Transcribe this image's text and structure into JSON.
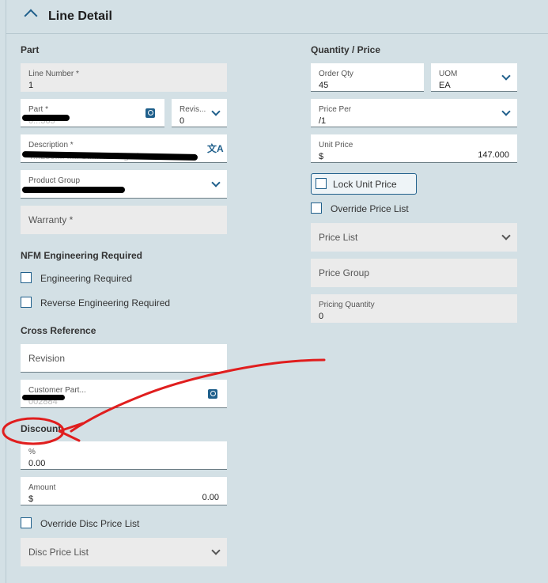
{
  "header": {
    "title": "Line Detail"
  },
  "part_section": {
    "title": "Part",
    "line_number": {
      "label": "Line Number *",
      "value": "1"
    },
    "part": {
      "label": "Part *",
      "value": "0...365"
    },
    "revision": {
      "label": "Revis...",
      "value": "0"
    },
    "description": {
      "label": "Description *",
      "value": "Y...250...P...ff St...k Mixing Pi..."
    },
    "product_group": {
      "label": "Product Group",
      "value": ""
    },
    "warranty": {
      "placeholder": "Warranty *"
    }
  },
  "nfm_section": {
    "title": "NFM Engineering Required",
    "engineering_required": "Engineering Required",
    "reverse_engineering_required": "Reverse Engineering Required"
  },
  "cross_ref_section": {
    "title": "Cross Reference",
    "revision": {
      "placeholder": "Revision"
    },
    "customer_part": {
      "label": "Customer Part...",
      "value": "002884"
    }
  },
  "discount_section": {
    "title": "Discount",
    "percent": {
      "label": "%",
      "value": "0.00"
    },
    "amount": {
      "label": "Amount",
      "currency": "$",
      "value": "0.00"
    },
    "override_disc": "Override Disc Price List",
    "disc_price_list": {
      "placeholder": "Disc Price List"
    }
  },
  "qty_section": {
    "title": "Quantity / Price",
    "order_qty": {
      "label": "Order Qty",
      "value": "45"
    },
    "uom": {
      "label": "UOM",
      "value": "EA"
    },
    "price_per": {
      "label": "Price Per",
      "value": "/1"
    },
    "unit_price": {
      "label": "Unit Price",
      "currency": "$",
      "value": "147.000"
    },
    "lock_unit_price": "Lock Unit Price",
    "override_price_list": "Override Price List",
    "price_list": {
      "placeholder": "Price List"
    },
    "price_group": {
      "placeholder": "Price Group"
    },
    "pricing_quantity": {
      "label": "Pricing Quantity",
      "value": "0"
    }
  },
  "colors": {
    "accent": "#1f5f8b",
    "annotation": "#e01e1e",
    "panel": "#d3e0e5"
  }
}
